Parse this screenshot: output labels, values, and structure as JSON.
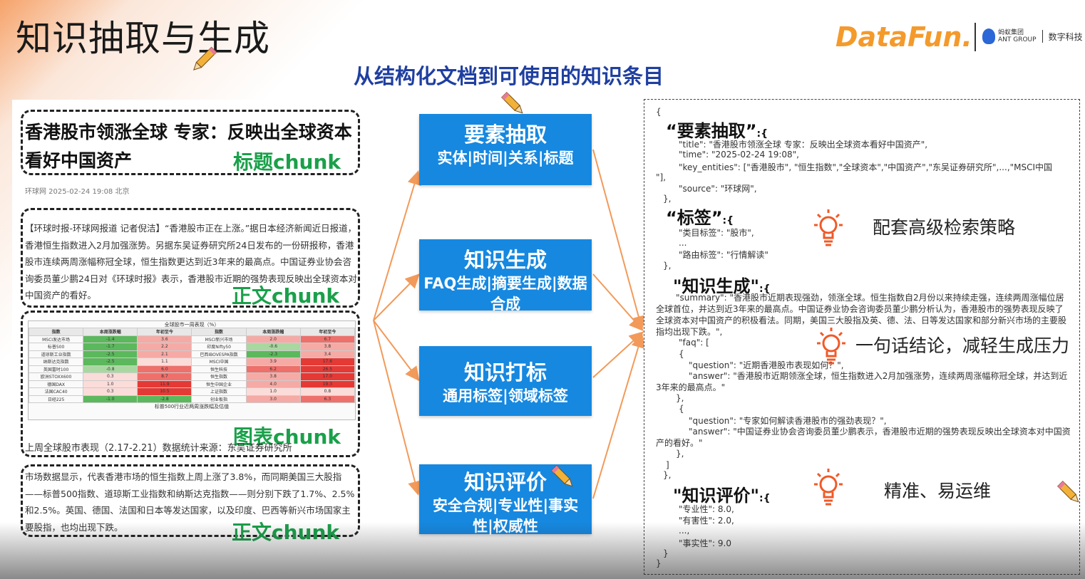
{
  "title": "知识抽取与生成",
  "subtitle": "从结构化文档到可使用的知识条目",
  "logos": {
    "datafun": "DataFun.",
    "ant_line1": "蚂蚁集团",
    "ant_line2": "ANT GROUP",
    "ant_digital": "数字科技"
  },
  "left": {
    "headline": "香港股市领涨全球 专家：反映出全球资本看好中国资产",
    "title_chunk_label": "标题chunk",
    "meta": "环球网  2025-02-24 19:08  北京",
    "body1": "【环球时报-环球网报道 记者倪洁】“香港股市正在上涨。”据日本经济新闻近日报道，香港恒生指数进入2月加强涨势。另据东吴证券研究所24日发布的一份研报称，香港股市连续两周涨幅称冠全球，恒生指数更达到近3年来的最高点。中国证券业协会咨询委员董少鹏24日对《环球时报》表示，香港股市近期的强势表现反映出全球资本对中国资产的看好。",
    "body_chunk_label": "正文chunk",
    "table": {
      "title": "全球股市一周表现（%）",
      "headers": [
        "指数",
        "本周涨跌幅",
        "年初至今",
        "指数",
        "本周涨跌幅",
        "年初至今"
      ],
      "rows": [
        [
          "MSCI发达市场",
          "-1.4",
          "3.6",
          "MSCI新兴市场",
          "2.0",
          "6.7"
        ],
        [
          "标普500",
          "-1.7",
          "2.2",
          "印度Nifty50",
          "-0.6",
          "3.8"
        ],
        [
          "道琼斯工业指数",
          "-2.5",
          "2.1",
          "巴西IBOVESPA指数",
          "-2.3",
          "3.4"
        ],
        [
          "纳斯达克指数",
          "-2.5",
          "1.1",
          "MSCI中国",
          "3.9",
          "17.6"
        ],
        [
          "英国富时100",
          "-0.8",
          "6.0",
          "恒生科技",
          "6.2",
          "26.5"
        ],
        [
          "欧洲STOXX600",
          "0.3",
          "8.7",
          "恒生指数",
          "3.8",
          "17.0"
        ],
        [
          "德国DAX",
          "1.0",
          "11.9",
          "恒生中国企业",
          "4.0",
          "19.3"
        ],
        [
          "法国CAC40",
          "0.3",
          "10.5",
          "上证指数",
          "1.0",
          "0.8"
        ],
        [
          "日经225",
          "-1.0",
          "-2.8",
          "创业板指",
          "3.0",
          "6.3"
        ]
      ],
      "footer": "标普500行业近两周涨跌幅及估值"
    },
    "table_chunk_label": "图表chunk",
    "table_caption": "上周全球股市表现（2.17-2.21）数据统计来源：东吴证券研究所",
    "body2": "市场数据显示，代表香港市场的恒生指数上周上涨了3.8%，而同期美国三大股指——标普500指数、道琼斯工业指数和纳斯达克指数——则分别下跌了1.7%、2.5%和2.5%。英国、德国、法国和日本等发达国家，以及印度、巴西等新兴市场国家主要股指，也均出现下跌。",
    "body2_chunk_label": "正文chunk"
  },
  "middle": [
    {
      "title": "要素抽取",
      "sub": "实体|时间|关系|标题"
    },
    {
      "title": "知识生成",
      "sub": "FAQ生成|摘要生成|数据合成"
    },
    {
      "title": "知识打标",
      "sub": "通用标签|领域标签"
    },
    {
      "title": "知识评价",
      "sub": "安全合规|专业性|事实性|权威性"
    }
  ],
  "right": {
    "open_brace": "{",
    "k1": "“要素抽取”",
    "k1_tail": ":{",
    "title_line": "\"title\": \"香港股市领涨全球 专家：反映出全球资本看好中国资产\",",
    "time_line": "\"time\": \"2025-02-24 19:08\",",
    "entities_line": "\"key_entities\": [\"香港股市\", \"恒生指数\",\"全球资本\",\"中国资产\",\"东吴证券研究所\",...,\"MSCI中国",
    "entities_line2": "\"],",
    "source_line": "\"source\": \"环球网\",",
    "close1": "},",
    "k2": "“标签”",
    "k2_tail": ":{",
    "tag1": "\"类目标签\": \"股市\",",
    "tag_dots": "...",
    "tag2": "\"路由标签\": \"行情解读\"",
    "close2": "},",
    "k3": "\"知识生成\"",
    "k3_tail": ":{",
    "summary": "\"summary\": \"香港股市近期表现强劲，领涨全球。恒生指数自2月份以来持续走强，连续两周涨幅位居全球首位，并达到近3年来的最高点。中国证券业协会咨询委员董少鹏分析认为，香港股市的强势表现反映了全球资本对中国资产的积极看法。同期，美国三大股指及英、德、法、日等发达国家和部分新兴市场的主要股指均出现下跌。\",",
    "faq_open": "\"faq\": [",
    "brace_open": "{",
    "q1": "\"question\": \"近期香港股市表现如何？\",",
    "a1": "\"answer\": \"香港股市近期领涨全球，恒生指数进入2月加强涨势，连续两周涨幅称冠全球，并达到近3年来的最高点。\"",
    "brace_close": "},",
    "brace_open2": "{",
    "q2": "\"question\": \"专家如何解读香港股市的强劲表现？\",",
    "a2": "\"answer\": \"中国证券业协会咨询委员董少鹏表示，香港股市近期的强势表现反映出全球资本对中国资产的看好。\"",
    "brace_close2": "},",
    "faq_close": "]",
    "close3": "},",
    "k4": "\"知识评价\"",
    "k4_tail": ":{",
    "eval1": "\"专业性\": 8.0,",
    "eval2": "\"有害性\": 2.0,",
    "eval_dots": "...,",
    "eval3": "\"事实性\": 9.0",
    "close4": "}",
    "close_final": "}"
  },
  "annotations": {
    "a1": "配套高级检索策略",
    "a2": "一句话结论，减轻生成压力",
    "a3": "精准、易运维"
  },
  "colors": {
    "box_blue": "#1688e0",
    "chunk_green": "#1aa04a",
    "arrow_orange": "#f29a5a",
    "subtitle_blue": "#1f3fa0",
    "bulb_orange": "#f05a28"
  }
}
